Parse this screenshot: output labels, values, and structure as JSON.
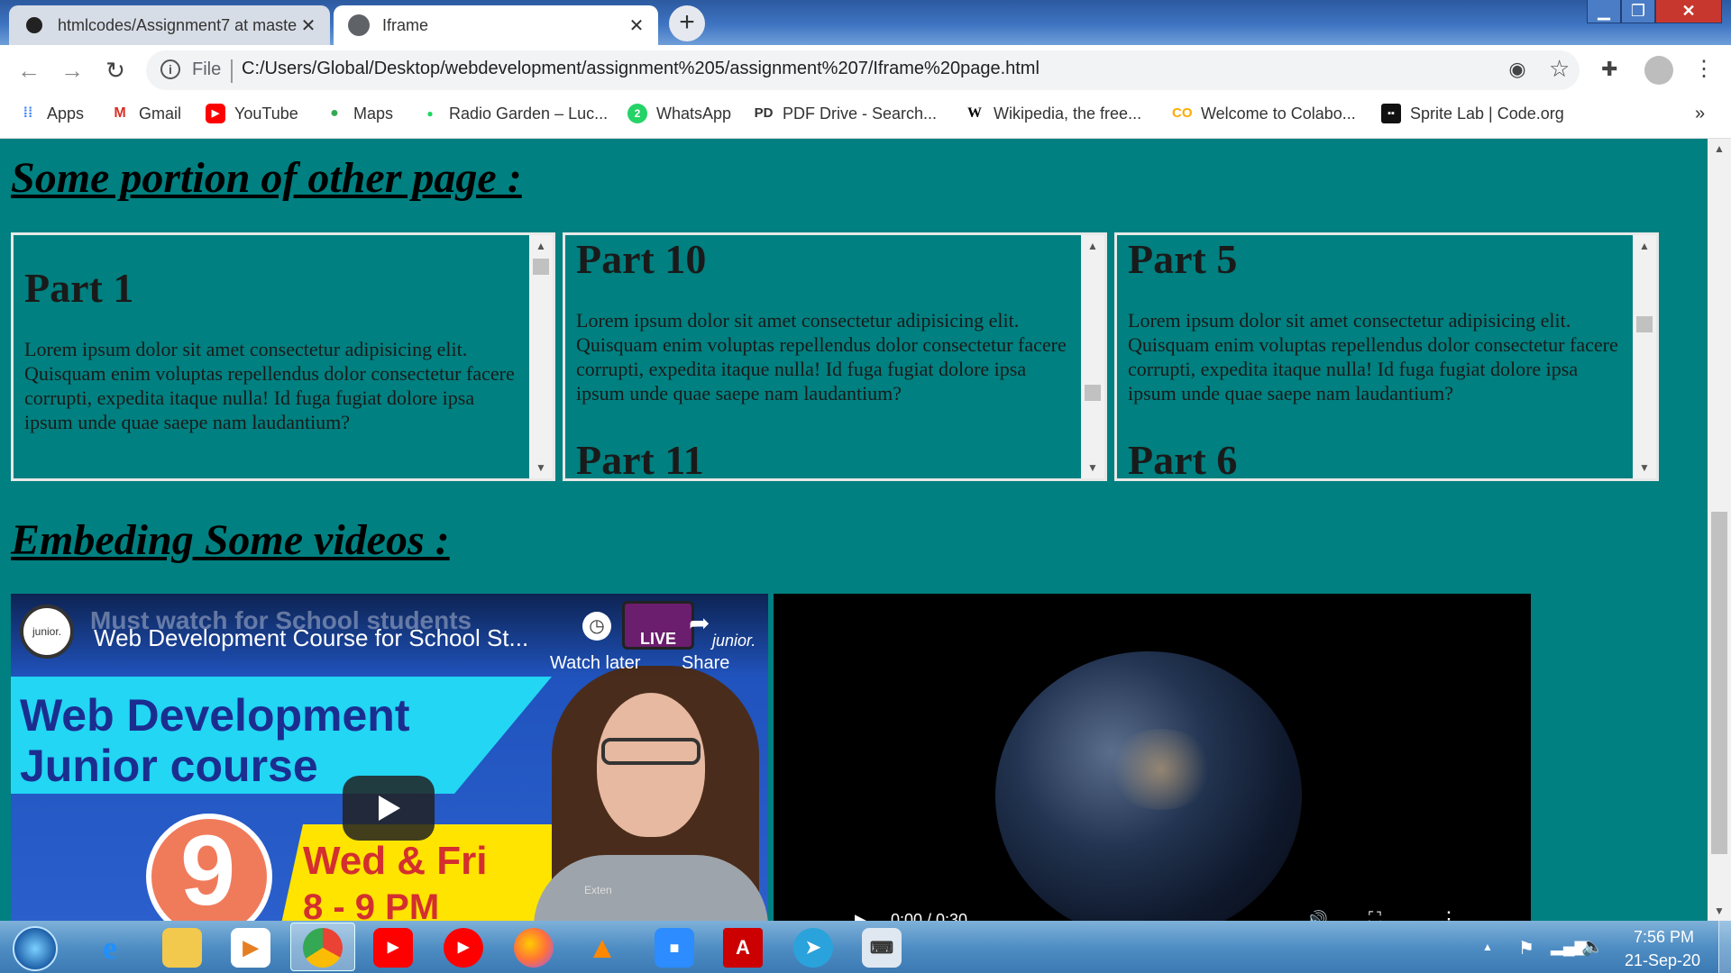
{
  "browser": {
    "tabs": [
      {
        "title": "htmlcodes/Assignment7 at maste",
        "close": "✕"
      },
      {
        "title": "Iframe",
        "close": "✕"
      }
    ],
    "new_tab": "+",
    "window_controls": {
      "minimize": "▁",
      "maximize": "❐",
      "close": "✕"
    },
    "nav": {
      "back": "←",
      "forward": "→",
      "reload": "↻"
    },
    "address": {
      "scheme_label": "File",
      "url": "C:/Users/Global/Desktop/webdevelopment/assignment%205/assignment%207/Iframe%20page.html"
    },
    "bookmarks": [
      {
        "label": "Apps",
        "icon": "apps-grid-icon"
      },
      {
        "label": "Gmail",
        "icon": "gmail-icon"
      },
      {
        "label": "YouTube",
        "icon": "youtube-icon"
      },
      {
        "label": "Maps",
        "icon": "maps-icon"
      },
      {
        "label": "Radio Garden – Luc...",
        "icon": "radio-garden-icon"
      },
      {
        "label": "WhatsApp",
        "icon": "whatsapp-icon"
      },
      {
        "label": "PDF Drive - Search...",
        "icon": "pdf-drive-icon"
      },
      {
        "label": "Wikipedia, the free...",
        "icon": "wikipedia-icon"
      },
      {
        "label": "Welcome to Colabo...",
        "icon": "colab-icon"
      },
      {
        "label": "Sprite Lab | Code.org",
        "icon": "code-org-icon"
      }
    ],
    "more_bookmarks": "»"
  },
  "page": {
    "heading1": "Some portion of other page :",
    "iframes": [
      {
        "part_a": "Part 1",
        "text": "Lorem ipsum dolor sit amet consectetur adipisicing elit. Quisquam enim voluptas repellendus dolor consectetur facere corrupti, expedita itaque nulla! Id fuga fugiat dolore ipsa ipsum unde quae saepe nam laudantium?",
        "part_b": ""
      },
      {
        "part_a": "Part 10",
        "text": "Lorem ipsum dolor sit amet consectetur adipisicing elit. Quisquam enim voluptas repellendus dolor consectetur facere corrupti, expedita itaque nulla! Id fuga fugiat dolore ipsa ipsum unde quae saepe nam laudantium?",
        "part_b": "Part 11"
      },
      {
        "part_a": "Part 5",
        "text": "Lorem ipsum dolor sit amet consectetur adipisicing elit. Quisquam enim voluptas repellendus dolor consectetur facere corrupti, expedita itaque nulla! Id fuga fugiat dolore ipsa ipsum unde quae saepe nam laudantium?",
        "part_b": "Part 6"
      }
    ],
    "heading2": "Embeding Some videos :",
    "youtube": {
      "title": "Web Development Course for School St...",
      "behind_title": "Must watch for School students",
      "watch_later": "Watch later",
      "share": "Share",
      "live": "LIVE",
      "brand": "junior.",
      "channel": "junior.",
      "thumb_line1": "Web Development",
      "thumb_line2": "Junior course",
      "thumb_number": "9",
      "thumb_days": "Wed & Fri",
      "thumb_time": "8 - 9 PM",
      "shirt_text": "Exten"
    },
    "video2": {
      "time": "0:00 / 0:30"
    }
  },
  "taskbar": {
    "clock_time": "7:56 PM",
    "clock_date": "21-Sep-20",
    "tray_arrow": "▲"
  }
}
